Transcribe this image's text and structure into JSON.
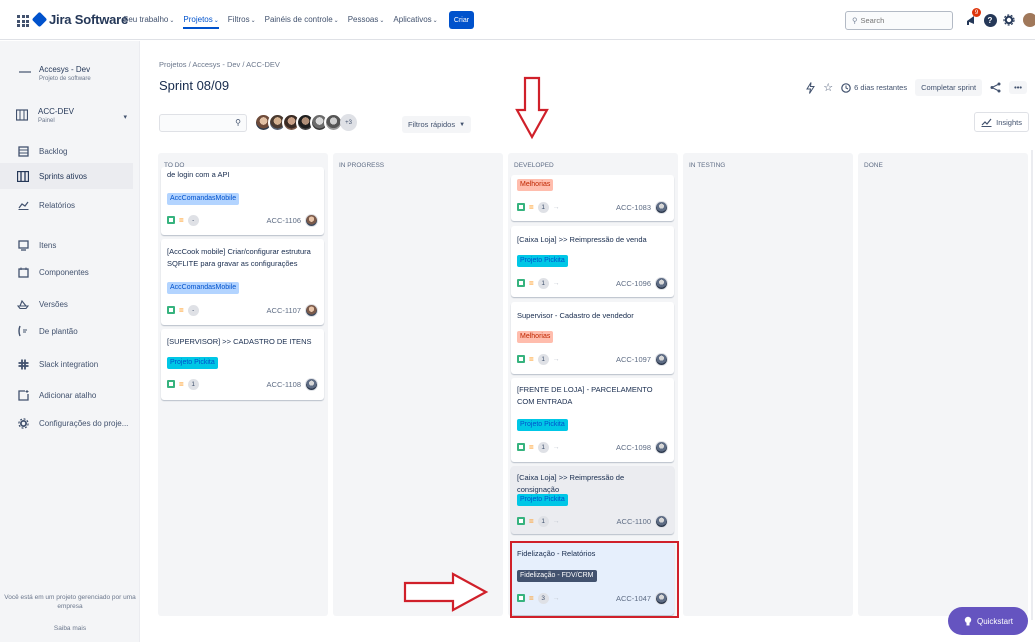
{
  "topnav": {
    "logo_text": "Jira Software",
    "items": [
      {
        "label": "Seu trabalho",
        "active": false
      },
      {
        "label": "Projetos",
        "active": true
      },
      {
        "label": "Filtros",
        "active": false
      },
      {
        "label": "Painéis de controle",
        "active": false
      },
      {
        "label": "Pessoas",
        "active": false
      },
      {
        "label": "Aplicativos",
        "active": false
      }
    ],
    "create_label": "Criar",
    "search_placeholder": "Search",
    "notification_count": "9",
    "help_label": "?"
  },
  "sidebar": {
    "project_name": "Accesys - Dev",
    "project_type": "Projeto de software",
    "board_name": "ACC-DEV",
    "board_type": "Painel",
    "items": [
      {
        "label": "Backlog",
        "icon": "backlog-icon",
        "active": false
      },
      {
        "label": "Sprints ativos",
        "icon": "board-icon",
        "active": true
      },
      {
        "label": "Relatórios",
        "icon": "chart-icon",
        "active": false
      },
      {
        "label": "Itens",
        "icon": "issues-icon",
        "active": false
      },
      {
        "label": "Componentes",
        "icon": "components-icon",
        "active": false
      },
      {
        "label": "Versões",
        "icon": "ship-icon",
        "active": false
      },
      {
        "label": "De plantão",
        "icon": "on-call-icon",
        "active": false
      },
      {
        "label": "Slack integration",
        "icon": "slack-icon",
        "active": false
      },
      {
        "label": "Adicionar atalho",
        "icon": "add-shortcut-icon",
        "active": false
      },
      {
        "label": "Configurações do proje...",
        "icon": "settings-icon",
        "active": false
      }
    ],
    "footer_text": "Você está em um projeto gerenciado por uma empresa",
    "learn_more": "Saiba mais"
  },
  "header": {
    "breadcrumb": "Projetos / Accesys - Dev / ACC-DEV",
    "title": "Sprint 08/09",
    "days_remaining": "6 dias restantes",
    "complete_sprint": "Completar sprint",
    "quick_filters": "Filtros rápidos",
    "avatars_more": "+3",
    "insights": "Insights"
  },
  "columns": [
    {
      "title": "TO DO"
    },
    {
      "title": "IN PROGRESS"
    },
    {
      "title": "DEVELOPED"
    },
    {
      "title": "IN TESTING"
    },
    {
      "title": "DONE"
    }
  ],
  "todo_cards": [
    {
      "title": "de login com a API",
      "tag": "AccComandasMobile",
      "points": "-",
      "key": "ACC-1106"
    },
    {
      "title": "[AccCook mobile] Criar/configurar estrutura SQFLITE para gravar as configurações",
      "tag": "AccComandasMobile",
      "points": "-",
      "key": "ACC-1107"
    },
    {
      "title": "[SUPERVISOR] >> CADASTRO DE ITENS",
      "tag": "Projeto Pickita",
      "points": "1",
      "key": "ACC-1108"
    }
  ],
  "developed_cards": [
    {
      "title": "",
      "tag": "Melhorias",
      "points": "1",
      "key": "ACC-1083"
    },
    {
      "title": "[Caixa Loja] >> Reimpressão de venda",
      "tag": "Projeto Pickita",
      "points": "1",
      "key": "ACC-1096"
    },
    {
      "title": "Supervisor - Cadastro de vendedor",
      "tag": "Melhorias",
      "points": "1",
      "key": "ACC-1097"
    },
    {
      "title": "[FRENTE DE LOJA] - PARCELAMENTO COM ENTRADA",
      "tag": "Projeto Pickita",
      "points": "1",
      "key": "ACC-1098"
    },
    {
      "title": "[Caixa Loja] >> Reimpressão de consignação",
      "tag": "Projeto Pickita",
      "points": "1",
      "key": "ACC-1100"
    },
    {
      "title": "Fidelização - Relatórios",
      "tag": "Fidelização - FDV/CRM",
      "points": "3",
      "key": "ACC-1047"
    }
  ],
  "quickstart": "Quickstart",
  "colors": {
    "primary": "#0052cc",
    "annotation_red": "#d0202a",
    "quickstart": "#6554c0"
  }
}
